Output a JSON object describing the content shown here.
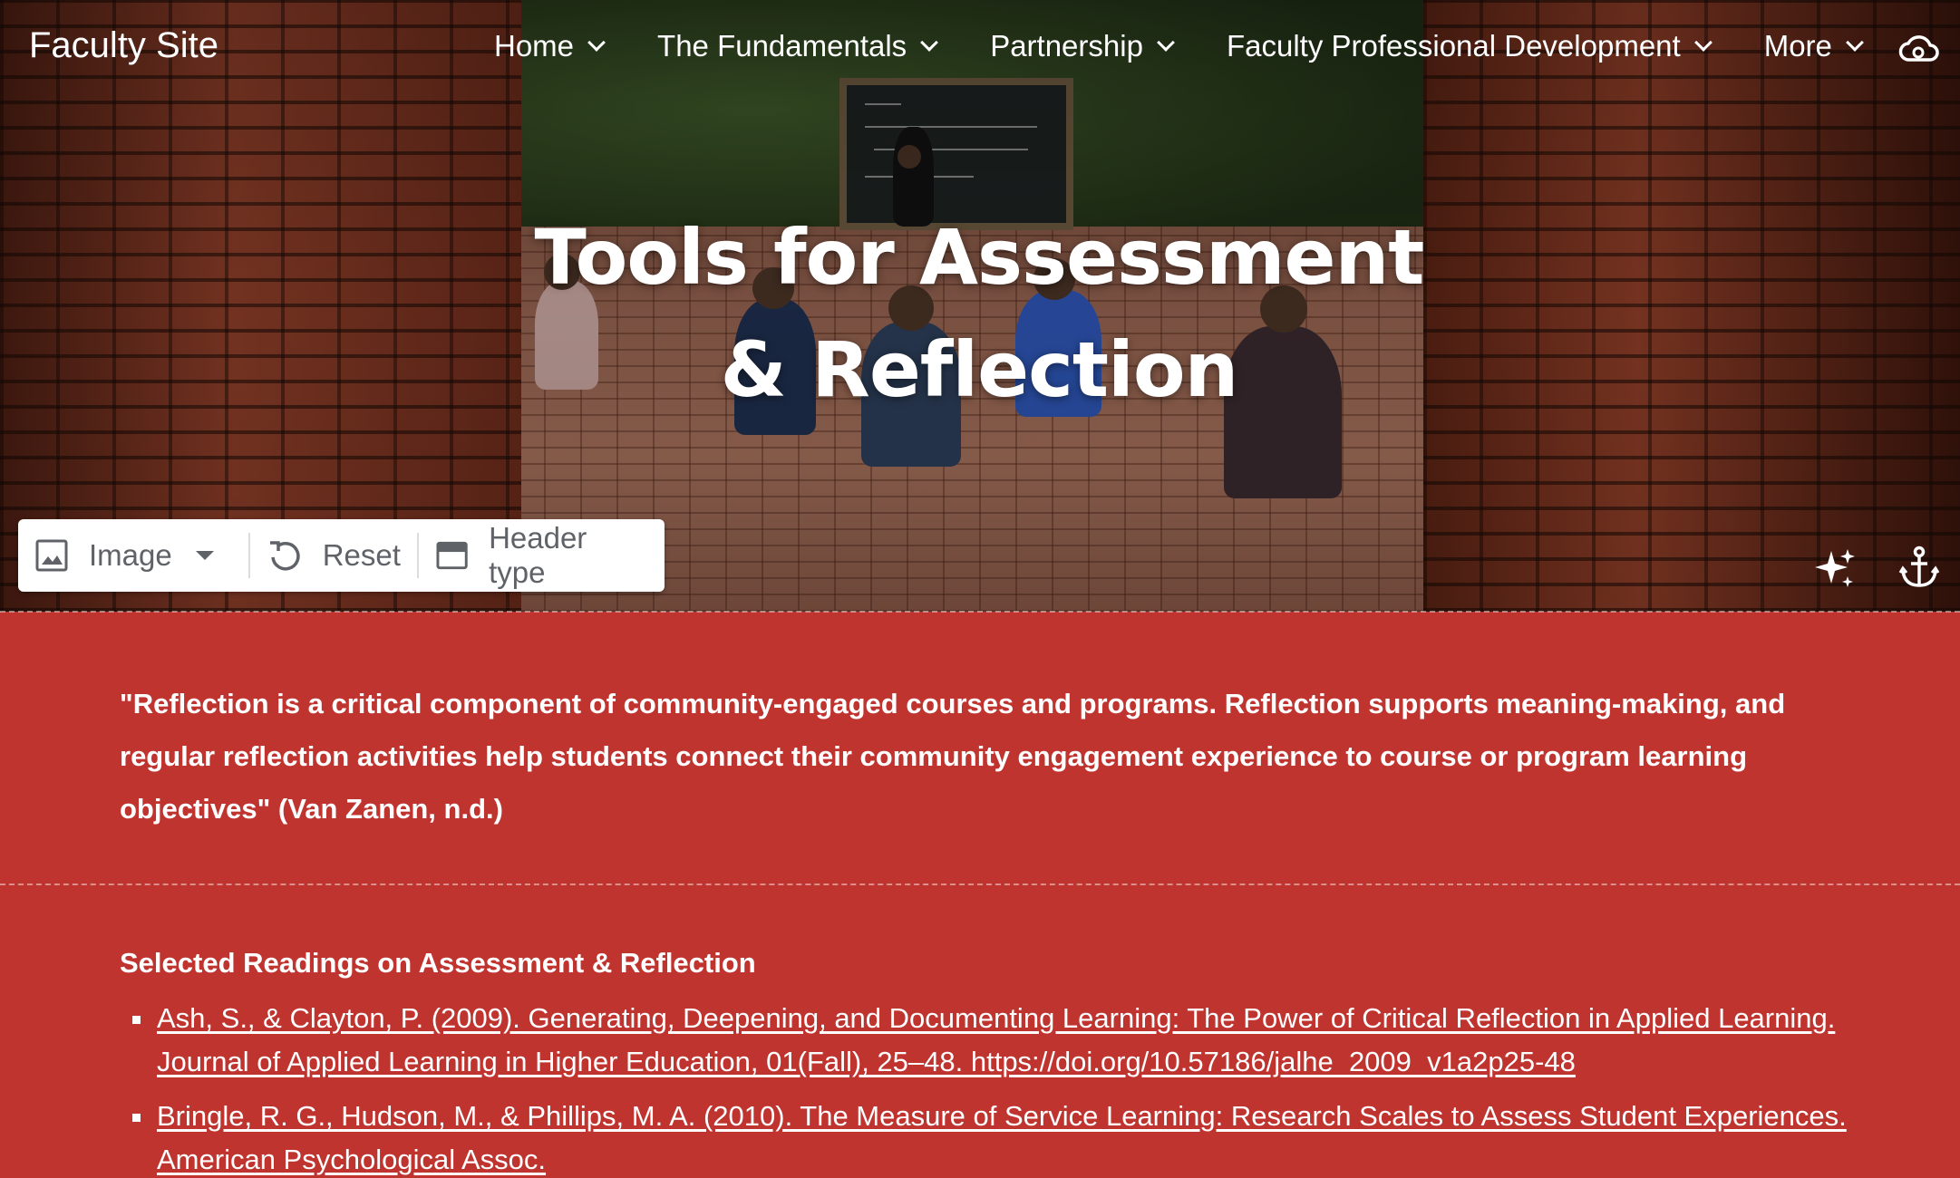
{
  "site": {
    "title": "Faculty Site"
  },
  "nav": {
    "items": [
      {
        "label": "Home"
      },
      {
        "label": "The Fundamentals"
      },
      {
        "label": "Partnership"
      },
      {
        "label": "Faculty Professional Development"
      },
      {
        "label": "More"
      }
    ]
  },
  "hero": {
    "title": "Tools for Assessment & Reflection"
  },
  "header_toolbar": {
    "image_label": "Image",
    "reset_label": "Reset",
    "header_type_label": "Header type"
  },
  "content": {
    "quote": "\"Reflection is a critical component of community-engaged courses and programs. Reflection supports meaning-making, and regular reflection activities help students connect their community engagement experience to course or  program learning objectives\" (Van Zanen, n.d.)",
    "readings_heading": "Selected Readings on Assessment & Reflection",
    "readings": [
      "Ash, S., & Clayton, P. (2009). Generating, Deepening, and Documenting Learning: The Power of Critical Reflection in Applied Learning. Journal of Applied Learning in Higher Education, 01(Fall), 25–48. https://doi.org/10.57186/jalhe_2009_v1a2p25-48",
      "Bringle, R. G., Hudson, M., & Phillips, M. A. (2010). The Measure of Service Learning: Research Scales to Assess Student Experiences. American Psychological Assoc."
    ]
  },
  "colors": {
    "accent": "#c0342f",
    "toolbar_text": "#5f6368"
  }
}
